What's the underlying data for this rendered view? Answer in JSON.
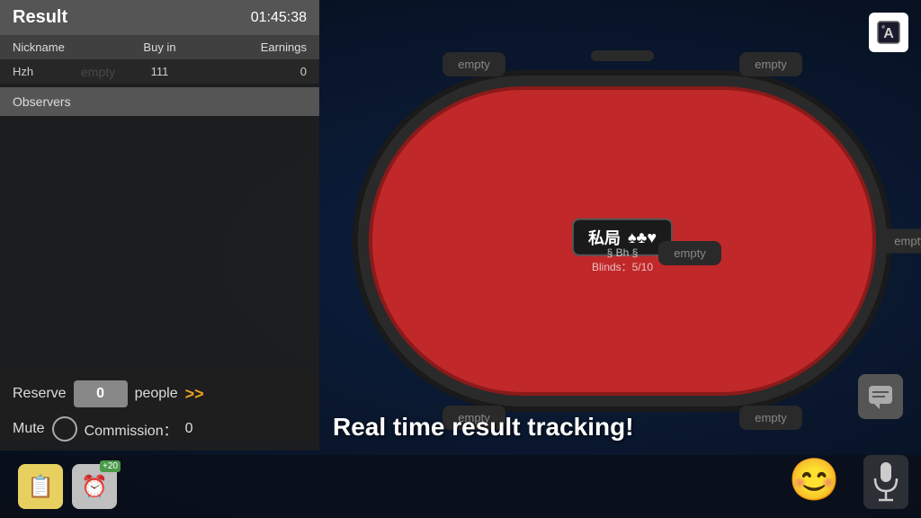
{
  "result_panel": {
    "title": "Result",
    "timer": "01:45:38",
    "headers": {
      "nickname": "Nickname",
      "buyin": "Buy in",
      "earnings": "Earnings"
    },
    "rows": [
      {
        "nickname": "Hzh",
        "buyin": "111",
        "earnings": "0",
        "watermark": "empty"
      }
    ],
    "observers_label": "Observers"
  },
  "controls": {
    "reserve_label": "Reserve",
    "reserve_value": "0",
    "people_label": "people",
    "arrows": ">>",
    "mute_label": "Mute",
    "commission_label": "Commission：",
    "commission_value": "0"
  },
  "table": {
    "logo_text": "私局",
    "suits": "♠♣♥",
    "game_info_line1": "§ Bh §",
    "game_info_line2": "Blinds：5/10",
    "seats": {
      "top_left": "empty",
      "top_right": "empty",
      "top_center": "",
      "mid_right": "empty",
      "bot_left": "empty",
      "bot_right": "empty",
      "mid_left": "empty"
    }
  },
  "bottom_bar": {
    "notes_icon": "📋",
    "alarm_icon": "⏰",
    "alarm_badge": "+20",
    "main_text": "Real time result tracking!"
  },
  "right_icons": {
    "card_icon": "🂡",
    "chat_icon": "💬",
    "emoji_icon": "😊",
    "mic_icon": "🎙"
  }
}
